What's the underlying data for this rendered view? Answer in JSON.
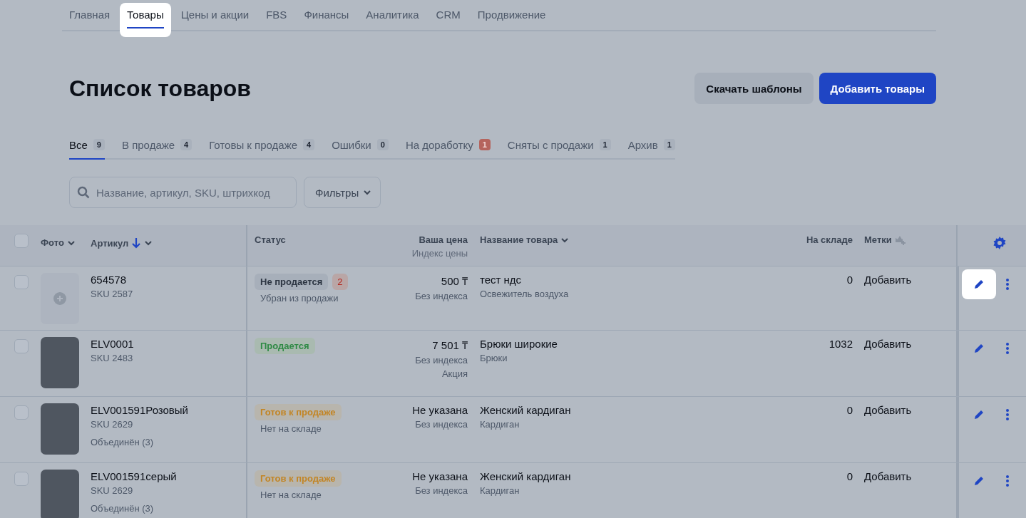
{
  "nav_tabs": [
    {
      "label": "Главная",
      "selected": false
    },
    {
      "label": "Товары",
      "selected": true
    },
    {
      "label": "Цены и акции",
      "selected": false
    },
    {
      "label": "FBS",
      "selected": false
    },
    {
      "label": "Финансы",
      "selected": false
    },
    {
      "label": "Аналитика",
      "selected": false
    },
    {
      "label": "CRM",
      "selected": false
    },
    {
      "label": "Продвижение",
      "selected": false
    }
  ],
  "page_title": "Список товаров",
  "header_buttons": [
    {
      "label": "Скачать шаблоны",
      "kind": "secondary"
    },
    {
      "label": "Добавить товары",
      "kind": "primary"
    }
  ],
  "status_tabs": [
    {
      "label": "Все",
      "count": "9",
      "selected": true,
      "alert": false
    },
    {
      "label": "В продаже",
      "count": "4",
      "selected": false,
      "alert": false
    },
    {
      "label": "Готовы к продаже",
      "count": "4",
      "selected": false,
      "alert": false
    },
    {
      "label": "Ошибки",
      "count": "0",
      "selected": false,
      "alert": false
    },
    {
      "label": "На доработку",
      "count": "1",
      "selected": false,
      "alert": true
    },
    {
      "label": "Сняты с продажи",
      "count": "1",
      "selected": false,
      "alert": false
    },
    {
      "label": "Архив",
      "count": "1",
      "selected": false,
      "alert": false
    }
  ],
  "search": {
    "placeholder": "Название, артикул, SKU, штрихкод"
  },
  "filters_button": "Фильтры",
  "table": {
    "all_checked": false,
    "columns": {
      "photo": "Фото",
      "article": "Артикул",
      "status": "Статус",
      "price": "Ваша цена",
      "price_index": "Индекс цены",
      "name": "Название товара",
      "stock": "На складе",
      "tags": "Метки"
    },
    "rows": [
      {
        "checked": false,
        "has_photo": false,
        "article": "654578",
        "sku": "SKU 2587",
        "status": {
          "label": "Не продается",
          "kind": "inactive",
          "count": "2"
        },
        "status_note": "Убран из продажи",
        "price": "500 ₸",
        "price_index": "Без индекса",
        "name": "тест ндс",
        "category": "Освежитель воздуха",
        "stock": "0",
        "tags": "Добавить",
        "edit_highlighted": true
      },
      {
        "checked": false,
        "has_photo": true,
        "article": "ELV0001",
        "sku": "SKU 2483",
        "status": {
          "label": "Продается",
          "kind": "selling"
        },
        "price": "7 501 ₸",
        "price_index": "Без индекса",
        "promo": "Акция",
        "name": "Брюки широкие",
        "category": "Брюки",
        "stock": "1032",
        "tags": "Добавить",
        "edit_highlighted": false
      },
      {
        "checked": false,
        "has_photo": true,
        "article": "ELV001591Розовый",
        "sku": "SKU 2629",
        "merged": "Объединён (3)",
        "status": {
          "label": "Готов к продаже",
          "kind": "ready"
        },
        "status_note": "Нет на складе",
        "price": "Не указана",
        "price_index": "Без индекса",
        "name": "Женский кардиган",
        "category": "Кардиган",
        "stock": "0",
        "tags": "Добавить",
        "edit_highlighted": false
      },
      {
        "checked": false,
        "has_photo": true,
        "article": "ELV001591серый",
        "sku": "SKU 2629",
        "merged": "Объединён (3)",
        "status": {
          "label": "Готов к продаже",
          "kind": "ready"
        },
        "status_note": "Нет на складе",
        "price": "Не указана",
        "price_index": "Без индекса",
        "name": "Женский кардиган",
        "category": "Кардиган",
        "stock": "0",
        "tags": "Добавить",
        "edit_highlighted": false
      }
    ]
  }
}
